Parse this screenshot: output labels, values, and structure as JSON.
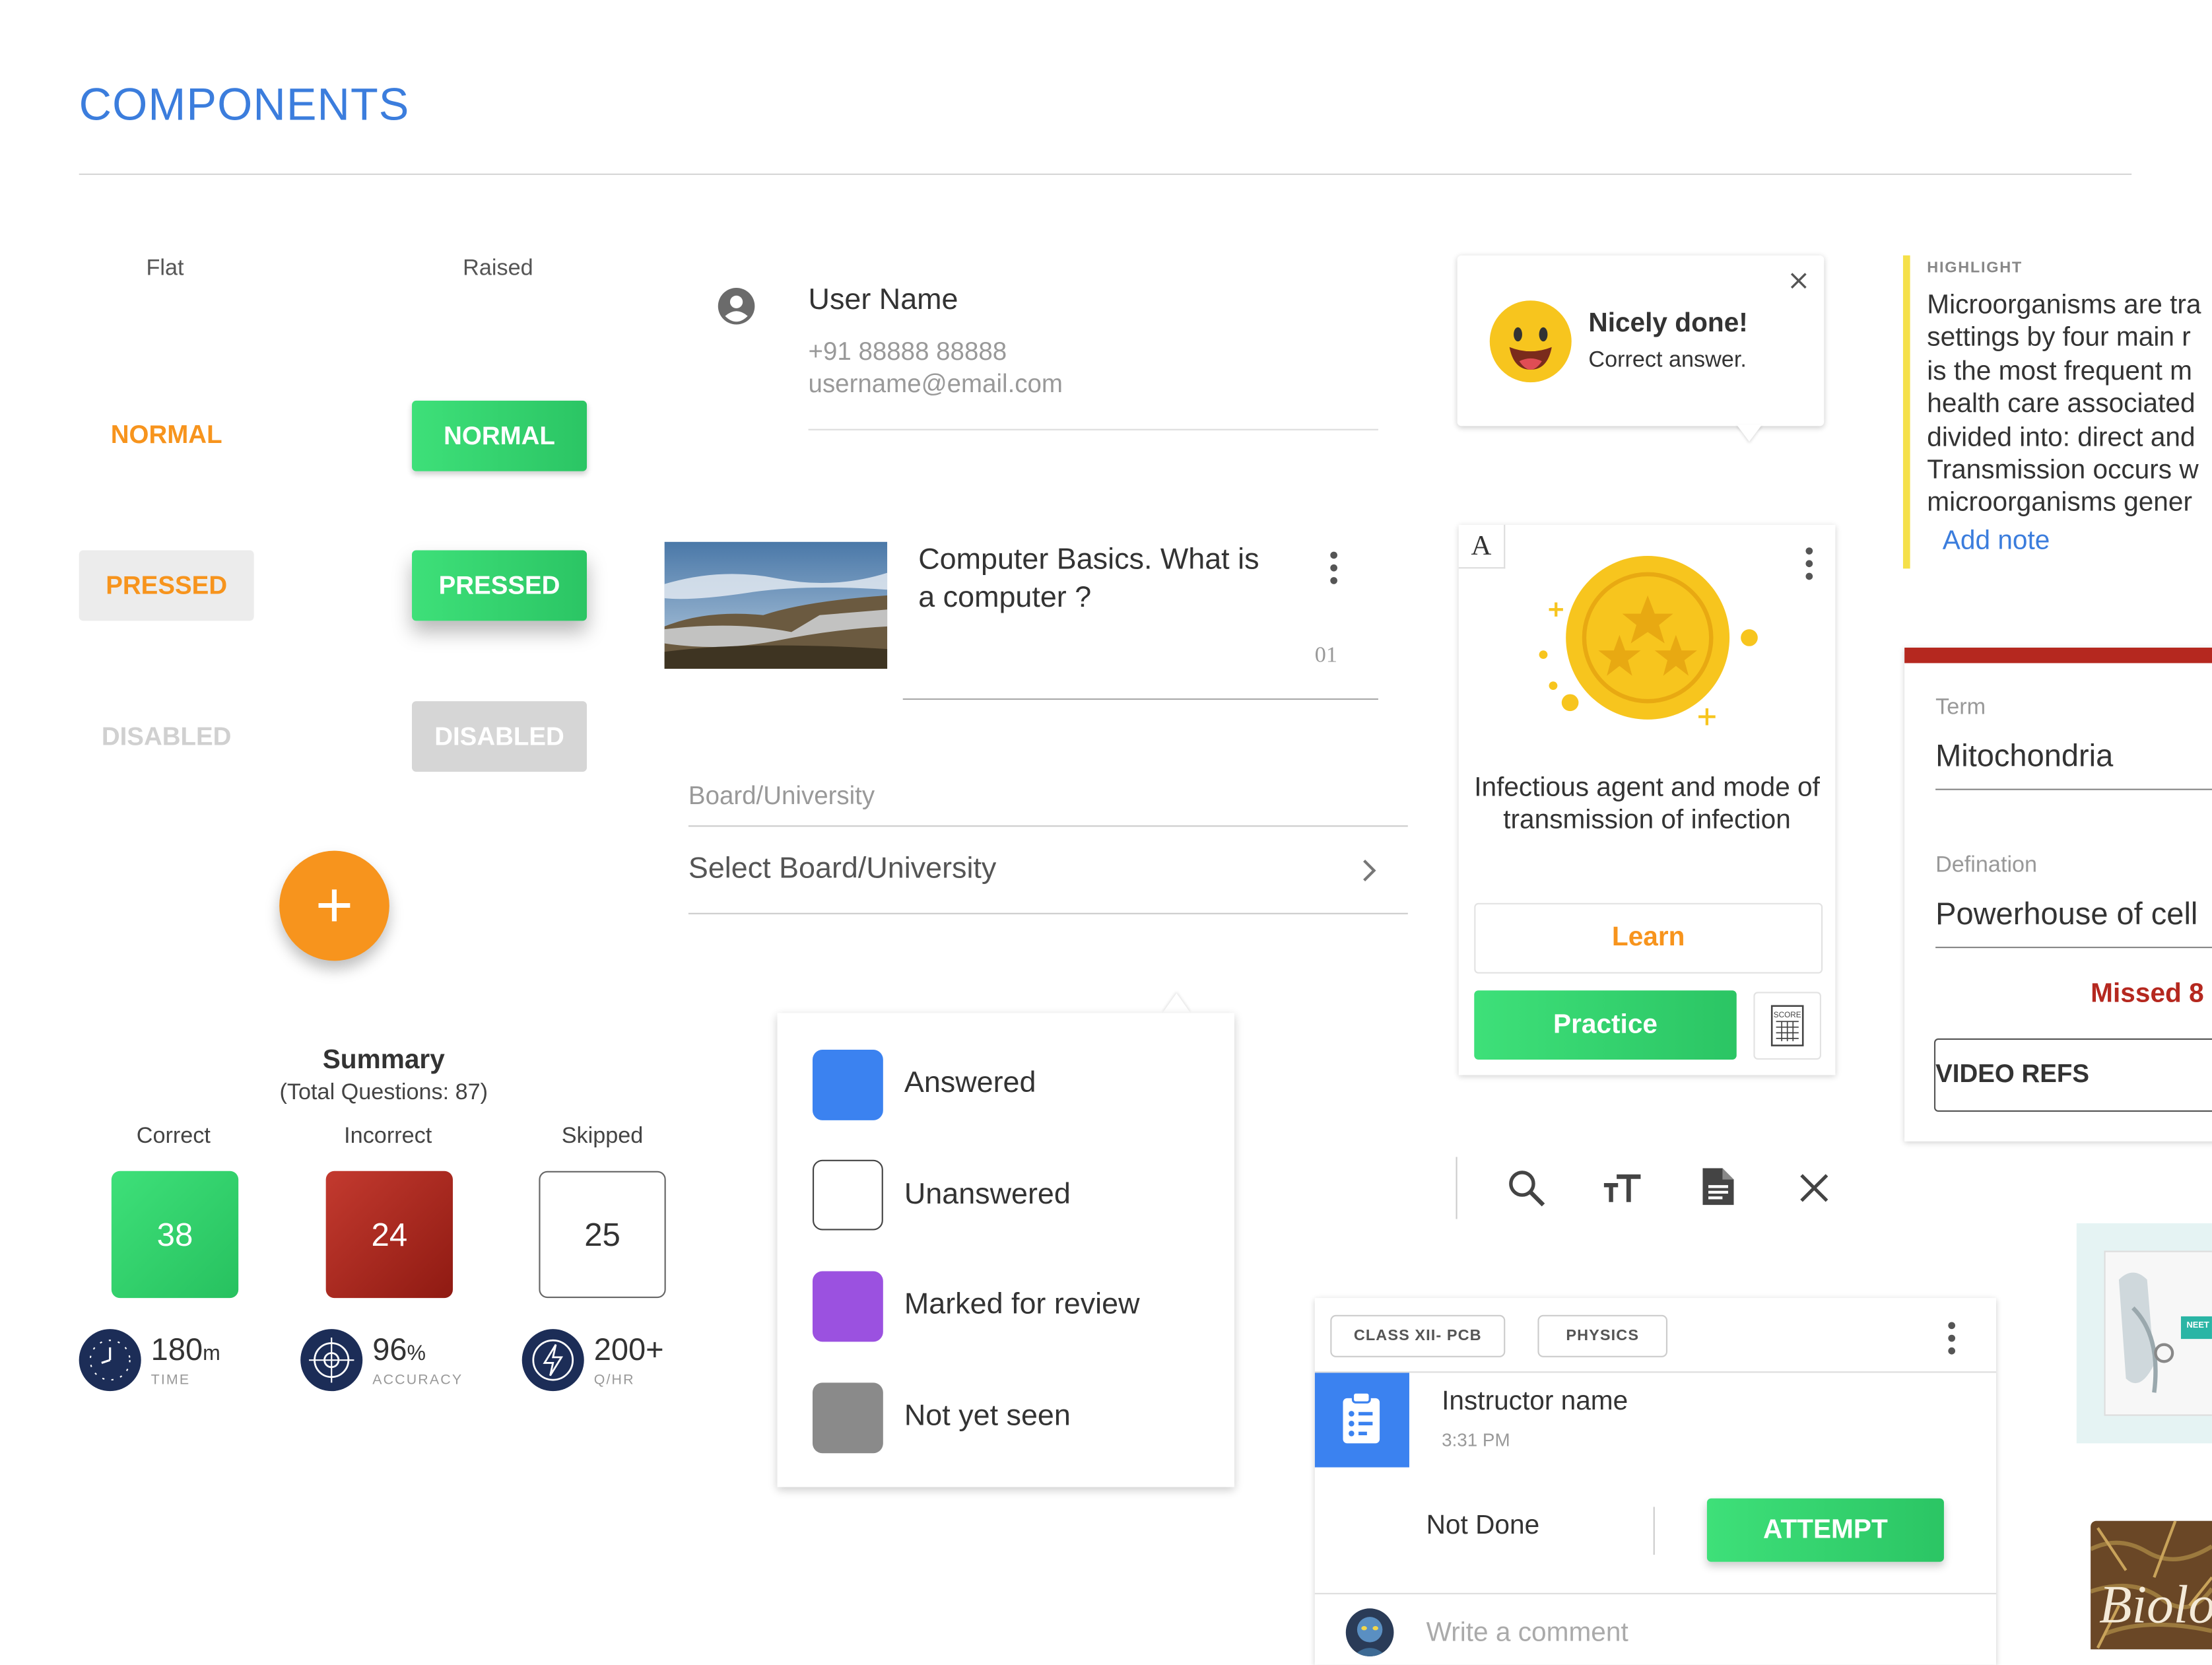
{
  "page": {
    "title": "COMPONENTS"
  },
  "buttons": {
    "flat_heading": "Flat",
    "raised_heading": "Raised",
    "flat": {
      "normal": "NORMAL",
      "pressed": "PRESSED",
      "disabled": "DISABLED"
    },
    "raised": {
      "normal": "NORMAL",
      "pressed": "PRESSED",
      "disabled": "DISABLED"
    },
    "fab_icon": "plus-icon",
    "colors": {
      "orange": "#f7941d",
      "green": "#2fd16b"
    }
  },
  "summary": {
    "title": "Summary",
    "subtitle": "(Total Questions: 87)",
    "stats": [
      {
        "label": "Correct",
        "value": "38",
        "color": "#2fd16b"
      },
      {
        "label": "Incorrect",
        "value": "24",
        "color": "#a8261d"
      },
      {
        "label": "Skipped",
        "value": "25",
        "color": "#ffffff"
      }
    ],
    "metrics": [
      {
        "value": "180",
        "unit": "m",
        "caption": "TIME",
        "icon": "clock-icon"
      },
      {
        "value": "96",
        "unit": "%",
        "caption": "ACCURACY",
        "icon": "target-icon"
      },
      {
        "value": "200+",
        "unit": "",
        "caption": "Q/HR",
        "icon": "lightning-icon"
      }
    ]
  },
  "profile": {
    "name": "User Name",
    "phone": "+91 88888 88888",
    "email": "username@email.com",
    "icon": "account-circle-icon"
  },
  "topic_item": {
    "title": "Computer Basics. What is a computer ?",
    "number": "01",
    "image": "landscape-thumbnail",
    "menu_icon": "more-vert-icon"
  },
  "board_select": {
    "label": "Board/University",
    "placeholder": "Select Board/University",
    "icon": "chevron-right-icon"
  },
  "legend": {
    "items": [
      {
        "label": "Answered",
        "color": "#3b82f0"
      },
      {
        "label": "Unanswered",
        "color": "#ffffff"
      },
      {
        "label": "Marked for review",
        "color": "#9b51e0"
      },
      {
        "label": "Not yet seen",
        "color": "#8a8a8a"
      }
    ]
  },
  "toast": {
    "title": "Nicely done!",
    "message": "Correct answer.",
    "close_icon": "close-icon",
    "emoji": "smiley-icon"
  },
  "topic_card": {
    "badge": "A",
    "title": "Infectious agent and mode of transmission of infection",
    "learn_label": "Learn",
    "practice_label": "Practice",
    "medal_icon": "star-medal-icon",
    "score_icon": "score-card-icon",
    "score_text": "SCORE"
  },
  "toolbar": {
    "icons": [
      "search-icon",
      "text-size-icon",
      "document-icon",
      "close-icon"
    ]
  },
  "highlight": {
    "heading": "HIGHLIGHT",
    "lines": [
      "Microorganisms are tra",
      "settings by four main r",
      "is the most frequent m",
      "health care associated",
      "divided into: direct and",
      "Transmission occurs w",
      "microorganisms gener"
    ],
    "add_note": "Add note"
  },
  "term_card": {
    "term_label": "Term",
    "term_value": "Mitochondria",
    "def_label": "Defination",
    "def_value": "Powerhouse of cell",
    "missed": "Missed 8",
    "video_refs": "VIDEO REFS"
  },
  "feed_card": {
    "chips": [
      "CLASS XII- PCB",
      "PHYSICS"
    ],
    "instructor": "Instructor name",
    "time": "3:31 PM",
    "status": "Not Done",
    "attempt_label": "ATTEMPT",
    "comment_placeholder": "Write a comment",
    "assignment_icon": "assignment-icon"
  },
  "thumbnails": {
    "top": {
      "badge": "NEET U",
      "image": "book-cover-thumbnail"
    },
    "bottom": {
      "title": "Biolo",
      "image": "biology-cover-thumbnail"
    }
  }
}
